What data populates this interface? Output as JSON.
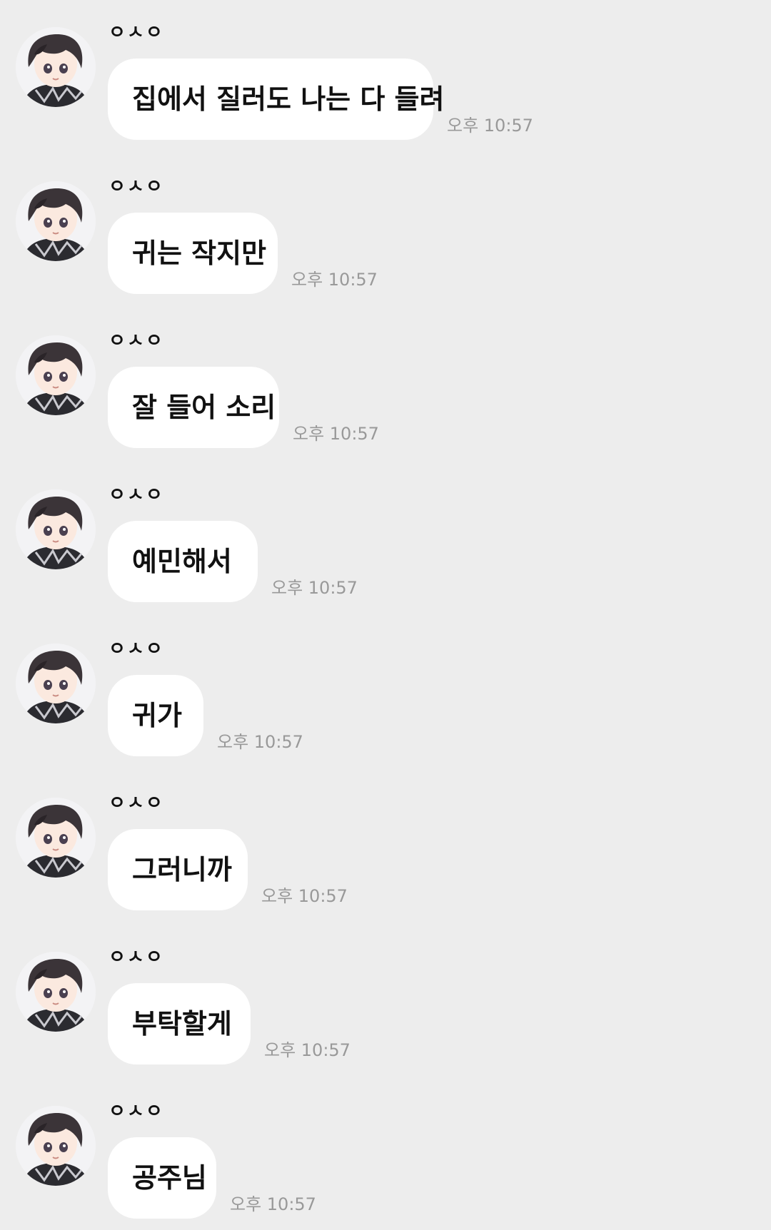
{
  "messages": [
    {
      "sender": "ㅇㅅㅇ",
      "text": "집에서 질러도 나는 다 들려",
      "time": "오후 10:57"
    },
    {
      "sender": "ㅇㅅㅇ",
      "text": "귀는 작지만",
      "time": "오후 10:57"
    },
    {
      "sender": "ㅇㅅㅇ",
      "text": "잘 들어 소리",
      "time": "오후 10:57"
    },
    {
      "sender": "ㅇㅅㅇ",
      "text": "예민해서",
      "time": "오후 10:57"
    },
    {
      "sender": "ㅇㅅㅇ",
      "text": "귀가",
      "time": "오후 10:57"
    },
    {
      "sender": "ㅇㅅㅇ",
      "text": "그러니까",
      "time": "오후 10:57"
    },
    {
      "sender": "ㅇㅅㅇ",
      "text": "부탁할게",
      "time": "오후 10:57"
    },
    {
      "sender": "ㅇㅅㅇ",
      "text": "공주님",
      "time": "오후 10:57"
    }
  ],
  "colors": {
    "background": "#ededed",
    "bubble": "#ffffff",
    "text": "#111111",
    "timestamp": "#999999"
  },
  "icons": {
    "avatar": "profile-avatar-icon"
  }
}
